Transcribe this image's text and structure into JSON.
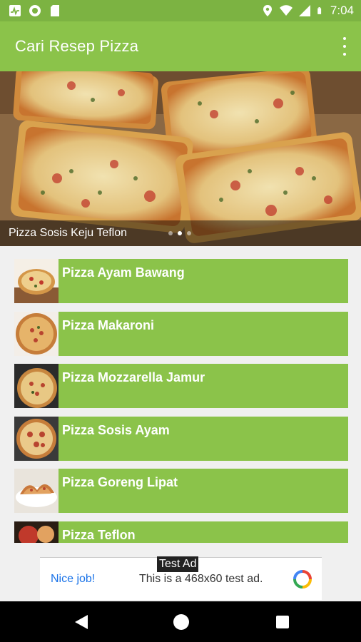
{
  "status_bar": {
    "time": "7:04",
    "left_icons": [
      "pulse-icon",
      "record-icon",
      "sd-card-icon"
    ],
    "right_icons": [
      "location-icon",
      "wifi-icon",
      "signal-icon",
      "battery-icon"
    ]
  },
  "app_bar": {
    "title": "Cari Resep Pizza",
    "menu_icon": "overflow-menu-icon"
  },
  "banner": {
    "caption": "Pizza Sosis Keju Teflon",
    "page_count": 3,
    "active_page": 2
  },
  "recipes": [
    {
      "name": "Pizza Ayam Bawang"
    },
    {
      "name": "Pizza Makaroni"
    },
    {
      "name": "Pizza Mozzarella Jamur"
    },
    {
      "name": "Pizza Sosis Ayam"
    },
    {
      "name": "Pizza Goreng Lipat"
    },
    {
      "name": "Pizza Teflon"
    }
  ],
  "ad": {
    "tag": "Test Ad",
    "headline": "Nice job!",
    "body": "This is a 468x60 test ad."
  },
  "colors": {
    "primary": "#8bc34a",
    "primary_dark": "#7cb342",
    "ad_link": "#1a73e8"
  }
}
